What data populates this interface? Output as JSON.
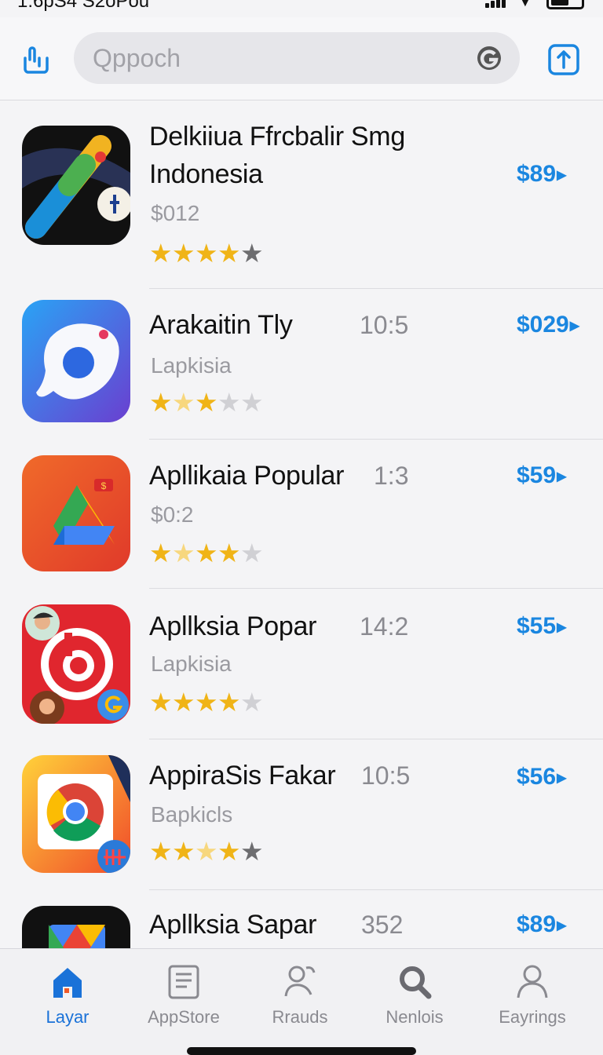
{
  "status_bar": {
    "time": "1:6pS4 S2oPou"
  },
  "header": {
    "left_icon": "share-icon",
    "search_placeholder": "Qppoch",
    "search_icon": "g-logo-icon",
    "right_icon": "external-link-icon"
  },
  "apps": [
    {
      "title": "Delkiiua Ffrcbalir Smg",
      "title_line2": "Indonesia",
      "meta": "",
      "subtitle": "$012",
      "price": "$89",
      "rating": [
        "full",
        "full",
        "full",
        "full",
        "dark"
      ],
      "icon": "app-icon-1"
    },
    {
      "title": "Arakaitin Tly",
      "title_line2": "",
      "meta": "10:5",
      "subtitle": "Lapkisia",
      "price": "$029",
      "rating": [
        "full",
        "half",
        "full",
        "empty",
        "empty"
      ],
      "icon": "app-icon-2"
    },
    {
      "title": "Apllikaia Popular",
      "title_line2": "",
      "meta": "1:3",
      "subtitle": "$0:2",
      "price": "$59",
      "rating": [
        "full",
        "half",
        "full",
        "full",
        "empty"
      ],
      "icon": "app-icon-3"
    },
    {
      "title": "Apllksia Popar",
      "title_line2": "",
      "meta": "14:2",
      "subtitle": "Lapkisia",
      "price": "$55",
      "rating": [
        "full",
        "full",
        "full",
        "full",
        "empty"
      ],
      "icon": "app-icon-4"
    },
    {
      "title": "AppiraSis Fakar",
      "title_line2": "",
      "meta": "10:5",
      "subtitle": "Bapkicls",
      "price": "$56",
      "rating": [
        "full",
        "full",
        "half",
        "full",
        "dark"
      ],
      "icon": "app-icon-5"
    },
    {
      "title": "Apllksia Sapar",
      "title_line2": "",
      "meta": "352",
      "subtitle": "",
      "price": "$89",
      "rating": [],
      "icon": "app-icon-6"
    }
  ],
  "tabs": [
    {
      "label": "Layar",
      "icon": "home-icon",
      "active": true
    },
    {
      "label": "AppStore",
      "icon": "document-icon",
      "active": false
    },
    {
      "label": "Rrauds",
      "icon": "people-icon",
      "active": false
    },
    {
      "label": "Nenlois",
      "icon": "search-icon",
      "active": false
    },
    {
      "label": "Eayrings",
      "icon": "person-icon",
      "active": false
    }
  ],
  "colors": {
    "accent": "#1a86e0",
    "tab_active": "#1a72d8",
    "star": "#f0b417"
  }
}
